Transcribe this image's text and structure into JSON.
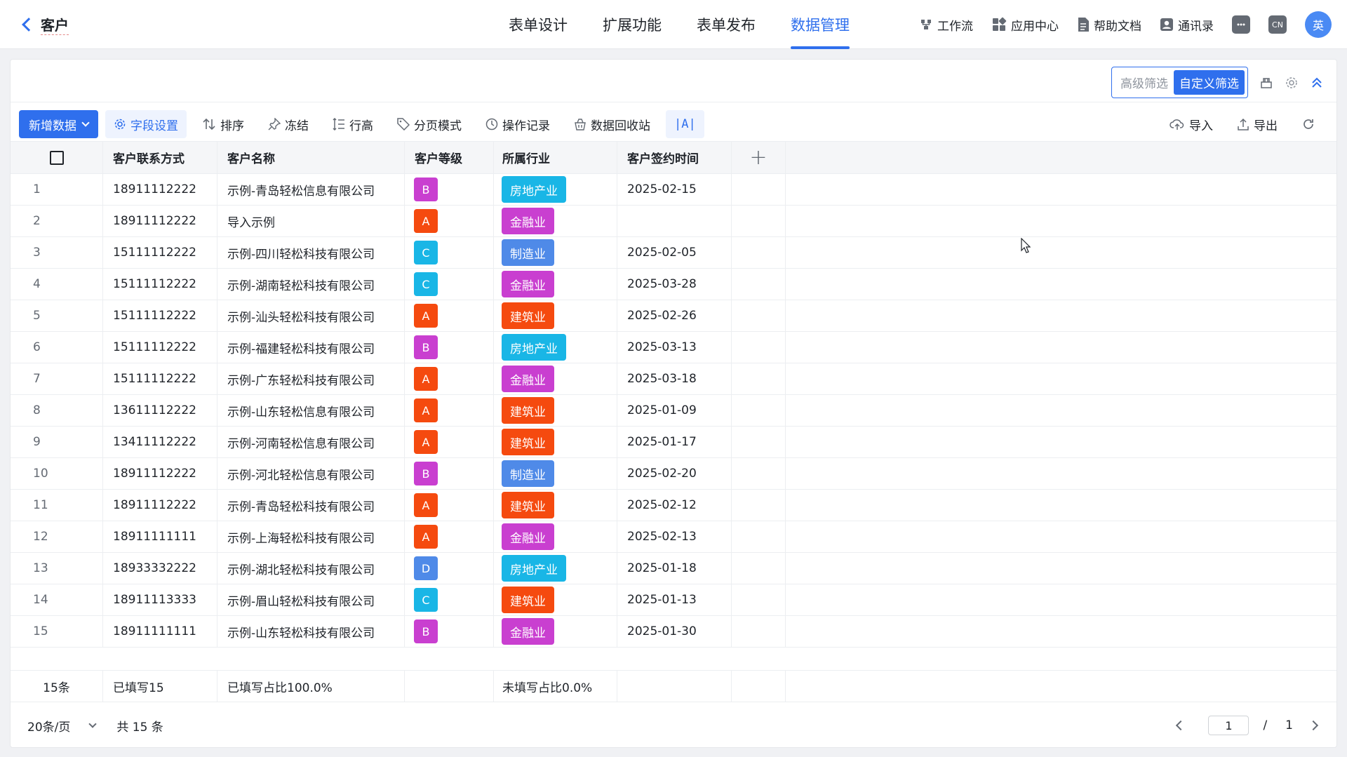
{
  "header": {
    "back_title": "客户",
    "tabs": [
      {
        "label": "表单设计"
      },
      {
        "label": "扩展功能"
      },
      {
        "label": "表单发布"
      },
      {
        "label": "数据管理"
      }
    ],
    "active_tab": "数据管理",
    "right_items": {
      "workflow": "工作流",
      "app_center": "应用中心",
      "help_docs": "帮助文档",
      "contacts": "通讯录",
      "lang_badge": "CN",
      "avatar": "英"
    }
  },
  "filters": {
    "advanced": "高级筛选",
    "custom": "自定义筛选"
  },
  "toolbar": {
    "add": "新增数据",
    "field_settings": "字段设置",
    "sort": "排序",
    "freeze": "冻结",
    "row_height": "行高",
    "page_mode": "分页模式",
    "op_log": "操作记录",
    "recycle": "数据回收站",
    "ai": "|A|",
    "import": "导入",
    "export": "导出"
  },
  "table": {
    "columns": [
      "客户联系方式",
      "客户名称",
      "客户等级",
      "所属行业",
      "客户签约时间"
    ],
    "rows": [
      {
        "n": "1",
        "phone": "18911112222",
        "name": "示例-青岛轻松信息有限公司",
        "level": "B",
        "industry": "房地产业",
        "date": "2025-02-15"
      },
      {
        "n": "2",
        "phone": "18911112222",
        "name": "导入示例",
        "level": "A",
        "industry": "金融业",
        "date": ""
      },
      {
        "n": "3",
        "phone": "15111112222",
        "name": "示例-四川轻松科技有限公司",
        "level": "C",
        "industry": "制造业",
        "date": "2025-02-05"
      },
      {
        "n": "4",
        "phone": "15111112222",
        "name": "示例-湖南轻松科技有限公司",
        "level": "C",
        "industry": "金融业",
        "date": "2025-03-28"
      },
      {
        "n": "5",
        "phone": "15111112222",
        "name": "示例-汕头轻松科技有限公司",
        "level": "A",
        "industry": "建筑业",
        "date": "2025-02-26"
      },
      {
        "n": "6",
        "phone": "15111112222",
        "name": "示例-福建轻松科技有限公司",
        "level": "B",
        "industry": "房地产业",
        "date": "2025-03-13"
      },
      {
        "n": "7",
        "phone": "15111112222",
        "name": "示例-广东轻松科技有限公司",
        "level": "A",
        "industry": "金融业",
        "date": "2025-03-18"
      },
      {
        "n": "8",
        "phone": "13611112222",
        "name": "示例-山东轻松信息有限公司",
        "level": "A",
        "industry": "建筑业",
        "date": "2025-01-09"
      },
      {
        "n": "9",
        "phone": "13411112222",
        "name": "示例-河南轻松信息有限公司",
        "level": "A",
        "industry": "建筑业",
        "date": "2025-01-17"
      },
      {
        "n": "10",
        "phone": "18911112222",
        "name": "示例-河北轻松信息有限公司",
        "level": "B",
        "industry": "制造业",
        "date": "2025-02-20"
      },
      {
        "n": "11",
        "phone": "18911112222",
        "name": "示例-青岛轻松科技有限公司",
        "level": "A",
        "industry": "建筑业",
        "date": "2025-02-12"
      },
      {
        "n": "12",
        "phone": "18911111111",
        "name": "示例-上海轻松科技有限公司",
        "level": "A",
        "industry": "金融业",
        "date": "2025-02-13"
      },
      {
        "n": "13",
        "phone": "18933332222",
        "name": "示例-湖北轻松科技有限公司",
        "level": "D",
        "industry": "房地产业",
        "date": "2025-01-18"
      },
      {
        "n": "14",
        "phone": "18911113333",
        "name": "示例-眉山轻松科技有限公司",
        "level": "C",
        "industry": "建筑业",
        "date": "2025-01-13"
      },
      {
        "n": "15",
        "phone": "18911111111",
        "name": "示例-山东轻松科技有限公司",
        "level": "B",
        "industry": "金融业",
        "date": "2025-01-30"
      }
    ],
    "level_colors": {
      "A": "#f54a0f",
      "B": "#c93fd0",
      "C": "#19b6e6",
      "D": "#4f8ae8"
    },
    "industry_colors": {
      "房地产业": "#19b6e6",
      "金融业": "#c93fd0",
      "制造业": "#4f8ae8",
      "建筑业": "#f54a0f"
    },
    "summary": {
      "count": "15条",
      "filled": "已填写15",
      "filled_ratio": "已填写占比100.0%",
      "unfilled_ratio": "未填写占比0.0%"
    }
  },
  "pagination": {
    "page_size": "20条/页",
    "total": "共 15 条",
    "current_page": "1",
    "slash": "/",
    "total_pages": "1"
  }
}
